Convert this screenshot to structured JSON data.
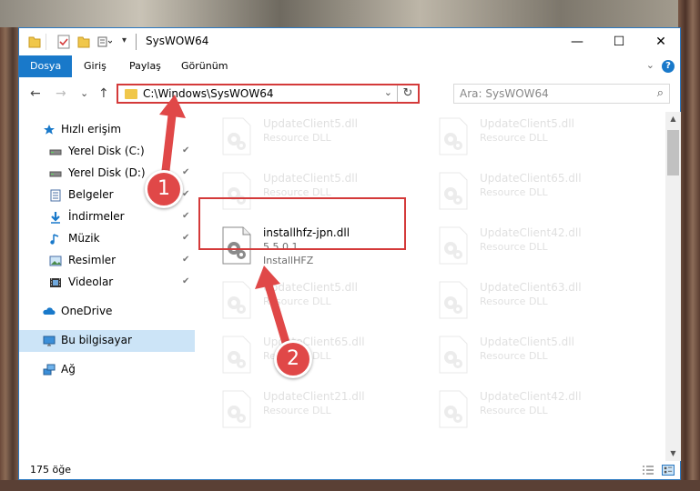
{
  "window": {
    "title": "SysWOW64",
    "buttons": {
      "minimize": "—",
      "maximize": "☐",
      "close": "✕"
    }
  },
  "ribbon": {
    "tabs": [
      "Dosya",
      "Giriş",
      "Paylaş",
      "Görünüm"
    ],
    "help": "?",
    "collapse": "⌄"
  },
  "nav": {
    "back": "←",
    "forward": "→",
    "recent": "⌄",
    "up": "↑"
  },
  "address": {
    "path": "C:\\Windows\\SysWOW64",
    "dropdown": "⌄",
    "refresh": "↻"
  },
  "search": {
    "placeholder": "Ara: SysWOW64",
    "icon": "⌕"
  },
  "sidebar": {
    "items": [
      {
        "label": "Hızlı erişim",
        "icon": "star-icon"
      },
      {
        "label": "Yerel Disk (C:)",
        "icon": "drive-icon",
        "pinned": true
      },
      {
        "label": "Yerel Disk (D:)",
        "icon": "drive-icon",
        "pinned": true
      },
      {
        "label": "Belgeler",
        "icon": "documents-icon",
        "pinned": true
      },
      {
        "label": "İndirmeler",
        "icon": "download-icon",
        "pinned": true
      },
      {
        "label": "Müzik",
        "icon": "music-icon",
        "pinned": true
      },
      {
        "label": "Resimler",
        "icon": "pictures-icon",
        "pinned": true
      },
      {
        "label": "Videolar",
        "icon": "videos-icon",
        "pinned": true
      },
      {
        "label": "OneDrive",
        "icon": "onedrive-icon"
      },
      {
        "label": "Bu bilgisayar",
        "icon": "computer-icon",
        "selected": true
      },
      {
        "label": "Ağ",
        "icon": "network-icon"
      }
    ],
    "pin_glyph": "📌"
  },
  "files": {
    "left": [
      {
        "name": "UpdateClient5.dll",
        "desc": "Resource DLL"
      },
      {
        "name": "UpdateClient5.dll",
        "desc": "Resource DLL"
      },
      {
        "name": "installhfz-jpn.dll",
        "desc": "5.5.0.1",
        "extra": "InstallHFZ"
      },
      {
        "name": "UpdateClient5.dll",
        "desc": "Resource DLL"
      },
      {
        "name": "UpdateClient65.dll",
        "desc": "Resource DLL"
      },
      {
        "name": "UpdateClient21.dll",
        "desc": "Resource DLL"
      }
    ],
    "right": [
      {
        "name": "UpdateClient5.dll",
        "desc": "Resource DLL"
      },
      {
        "name": "UpdateClient65.dll",
        "desc": "Resource DLL"
      },
      {
        "name": "UpdateClient42.dll",
        "desc": "Resource DLL"
      },
      {
        "name": "UpdateClient63.dll",
        "desc": "Resource DLL"
      },
      {
        "name": "UpdateClient5.dll",
        "desc": "Resource DLL"
      },
      {
        "name": "UpdateClient42.dll",
        "desc": "Resource DLL"
      }
    ]
  },
  "status": {
    "count": "175 öğe"
  },
  "markers": [
    "1",
    "2"
  ],
  "colors": {
    "accent": "#1979ca",
    "annotation": "#e04848",
    "selection": "#cce4f7"
  }
}
